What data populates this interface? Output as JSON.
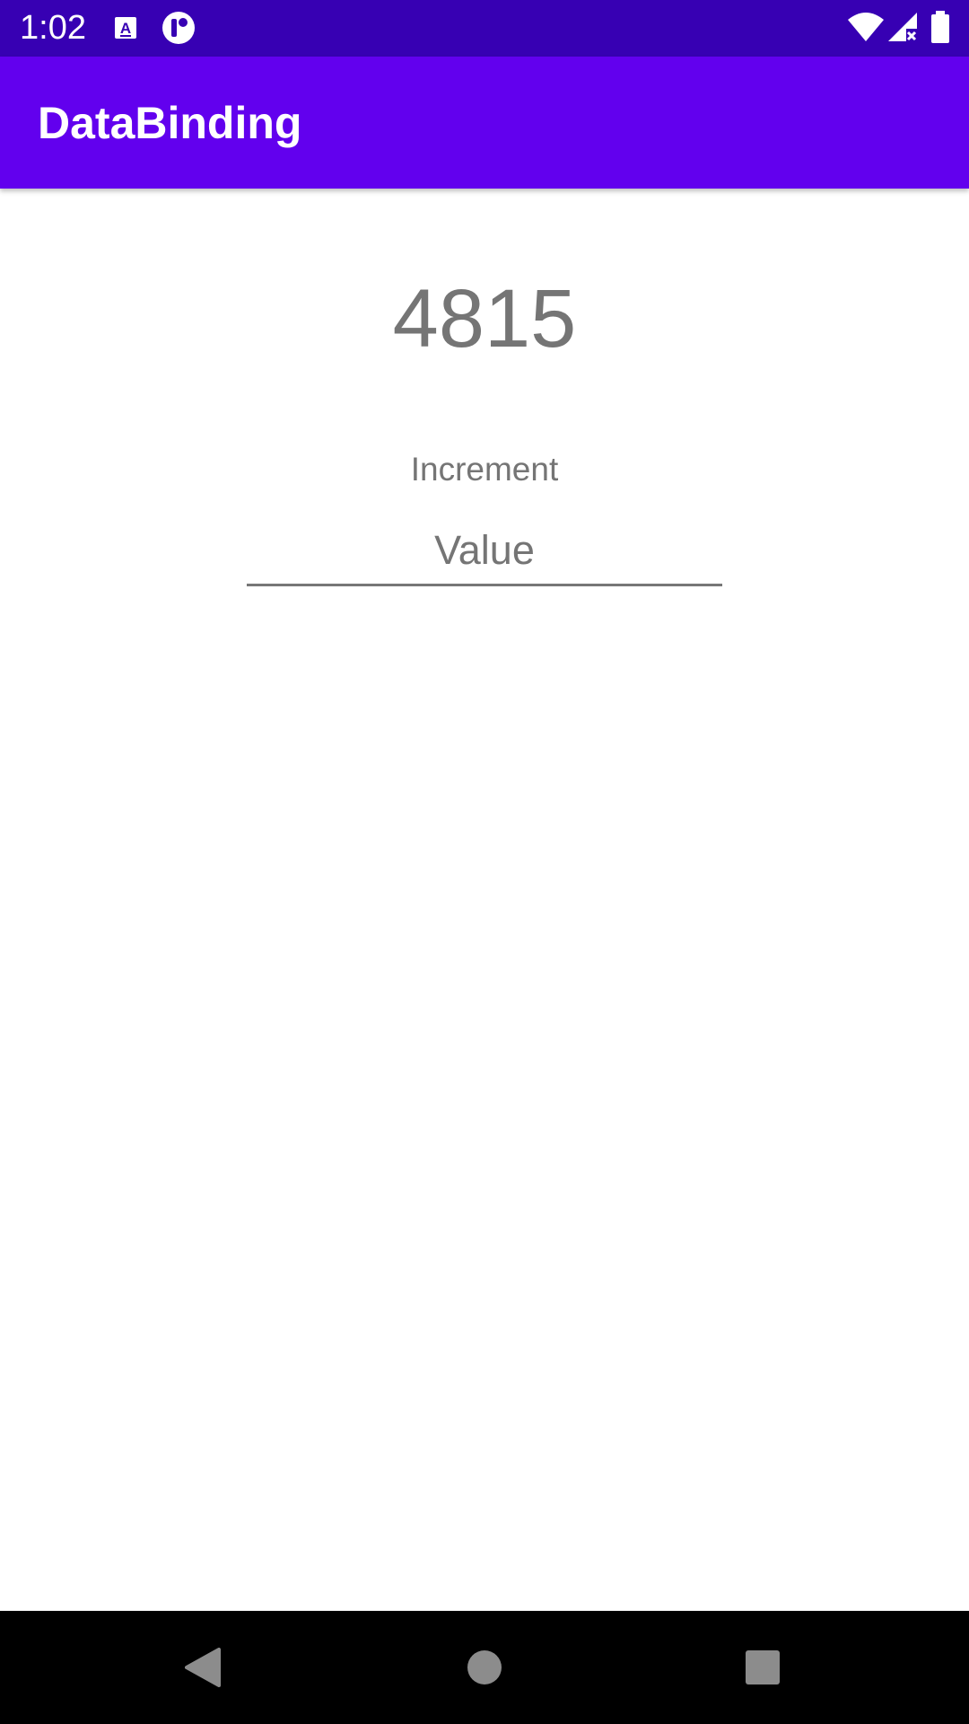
{
  "status_bar": {
    "time": "1:02",
    "color": "#3700B3",
    "left_icons": [
      "a11y-a-icon",
      "notification-circle-icon"
    ],
    "right_icons": [
      "wifi-icon",
      "signal-no-data-icon",
      "battery-icon"
    ]
  },
  "app_bar": {
    "title": "DataBinding",
    "color": "#6200EE"
  },
  "main": {
    "counter_value": "4815",
    "increment_label": "Increment",
    "value_input": {
      "value": "",
      "placeholder": "Value"
    }
  },
  "nav_bar": {
    "buttons": [
      "back-icon",
      "home-icon",
      "recents-icon"
    ]
  }
}
